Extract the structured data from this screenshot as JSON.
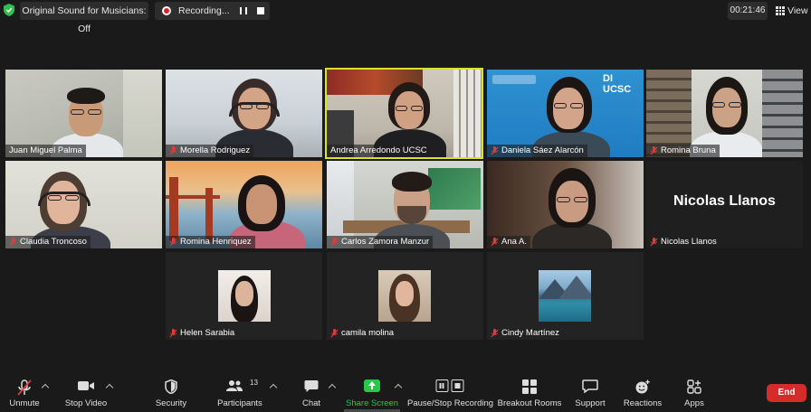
{
  "topbar": {
    "sound_label": "Original Sound for Musicians: Off",
    "recording_label": "Recording...",
    "timer": "00:21:46",
    "view_label": "View"
  },
  "participants": [
    {
      "name": "Juan Miguel Palma",
      "muted": false
    },
    {
      "name": "Morella Rodriguez",
      "muted": true
    },
    {
      "name": "Andrea Arredondo UCSC",
      "muted": false,
      "active_speaker": true
    },
    {
      "name": "Daniela Sáez Alarcón",
      "muted": true
    },
    {
      "name": "Romina Bruna",
      "muted": true
    },
    {
      "name": "Claudia Troncoso",
      "muted": true
    },
    {
      "name": "Romina Henriquez",
      "muted": true
    },
    {
      "name": "Carlos Zamora Manzur",
      "muted": true
    },
    {
      "name": "Ana A.",
      "muted": true
    },
    {
      "name": "Nicolas Llanos",
      "muted": true,
      "video_off_name": "Nicolas Llanos"
    },
    {
      "name": "Helen Sarabia",
      "muted": true
    },
    {
      "name": "camila molina",
      "muted": true
    },
    {
      "name": "Cindy Martínez",
      "muted": true
    }
  ],
  "tile4_banner": "DI UCSC",
  "toolbar": {
    "unmute": "Unmute",
    "stop_video": "Stop Video",
    "security": "Security",
    "participants": "Participants",
    "participants_count": "13",
    "chat": "Chat",
    "share_screen": "Share Screen",
    "pause_stop_recording": "Pause/Stop Recording",
    "breakout_rooms": "Breakout Rooms",
    "support": "Support",
    "reactions": "Reactions",
    "apps": "Apps",
    "end": "End"
  },
  "colors": {
    "accent_green": "#27c84a",
    "end_red": "#d42b2b",
    "active_speaker_border": "#d8e32c",
    "mute_red": "#e23b3b"
  }
}
